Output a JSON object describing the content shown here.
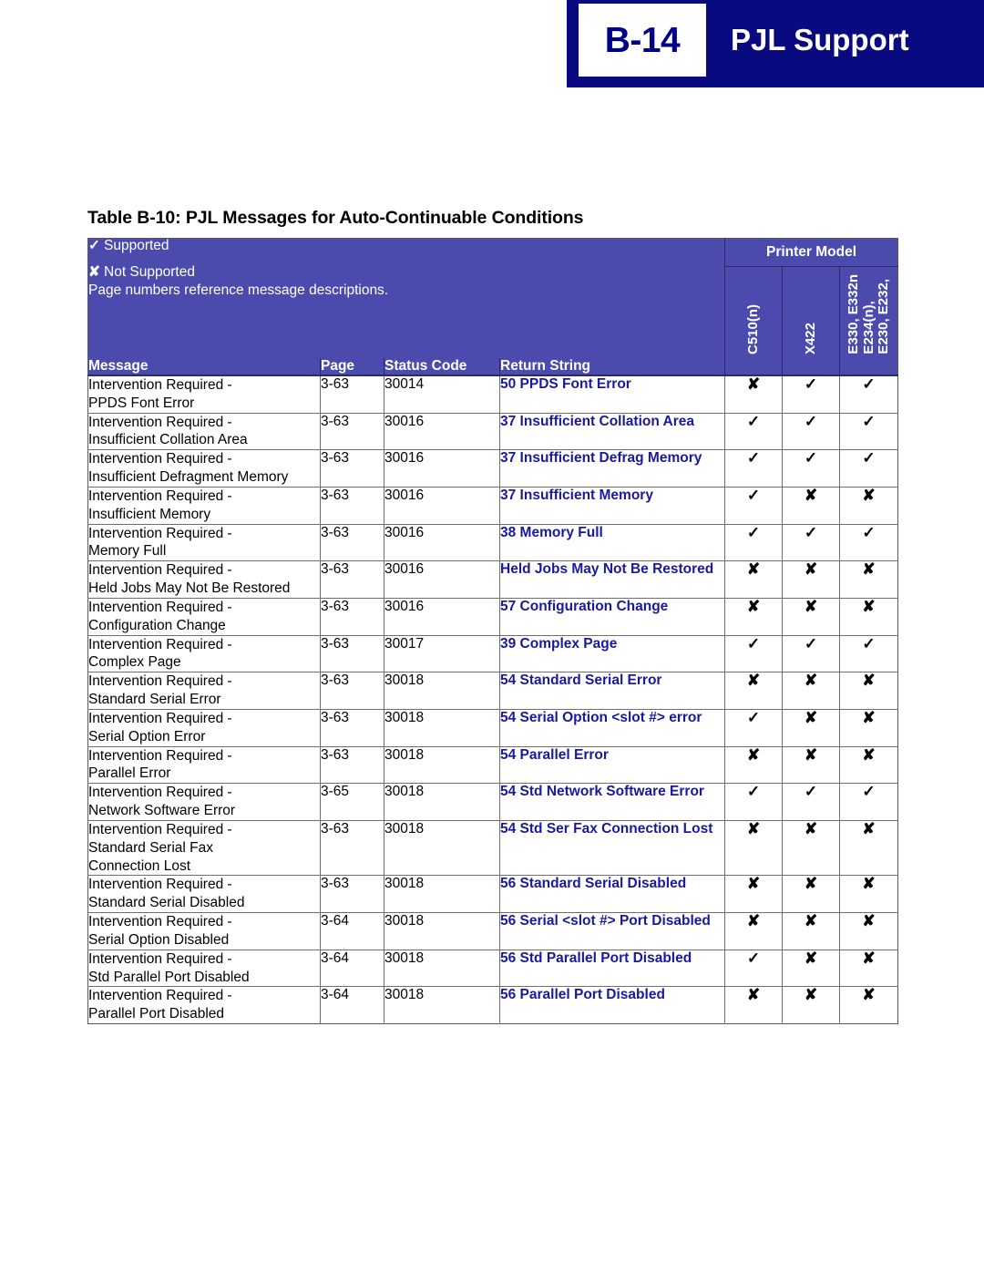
{
  "header": {
    "page_badge": "B-14",
    "title": "PJL Support",
    "navy": "#0a0a80"
  },
  "table_caption": "Table B-10:  PJL Messages for Auto-Continuable Conditions",
  "legend": {
    "supported_mark": "✓",
    "supported_label": "Supported",
    "not_supported_mark": "✘",
    "not_supported_label": "Not Supported",
    "note": "Page numbers reference message descriptions.",
    "header_color": "#4b4bad"
  },
  "table": {
    "printer_model_group": "Printer Model",
    "columns": {
      "message": "Message",
      "page": "Page",
      "status_code": "Status Code",
      "return_string": "Return String"
    },
    "model_columns": [
      {
        "lines": [
          "C510(n)"
        ]
      },
      {
        "lines": [
          "X422"
        ]
      },
      {
        "lines": [
          "E230, E232,",
          "E234(n),",
          "E330, E332n"
        ]
      }
    ],
    "marks": {
      "yes": "✓",
      "no": "✘"
    },
    "rows": [
      {
        "message": [
          "Intervention Required -",
          "PPDS Font Error"
        ],
        "page": "3-63",
        "status_code": "30014",
        "return_string": "50 PPDS Font Error",
        "support": [
          "✘",
          "✓",
          "✓"
        ]
      },
      {
        "message": [
          "Intervention Required -",
          "Insufficient Collation Area"
        ],
        "page": "3-63",
        "status_code": "30016",
        "return_string": "37 Insufficient Collation Area",
        "support": [
          "✓",
          "✓",
          "✓"
        ]
      },
      {
        "message": [
          "Intervention Required -",
          "Insufficient Defragment Memory"
        ],
        "page": "3-63",
        "status_code": "30016",
        "return_string": "37 Insufficient Defrag Memory",
        "support": [
          "✓",
          "✓",
          "✓"
        ]
      },
      {
        "message": [
          "Intervention Required -",
          "Insufficient Memory"
        ],
        "page": "3-63",
        "status_code": "30016",
        "return_string": "37 Insufficient Memory",
        "support": [
          "✓",
          "✘",
          "✘"
        ]
      },
      {
        "message": [
          "Intervention Required -",
          "Memory Full"
        ],
        "page": "3-63",
        "status_code": "30016",
        "return_string": "38 Memory Full",
        "support": [
          "✓",
          "✓",
          "✓"
        ]
      },
      {
        "message": [
          "Intervention Required -",
          "Held Jobs May Not Be Restored"
        ],
        "page": "3-63",
        "status_code": "30016",
        "return_string": "Held Jobs May Not Be Restored",
        "support": [
          "✘",
          "✘",
          "✘"
        ]
      },
      {
        "message": [
          "Intervention Required -",
          "Configuration Change"
        ],
        "page": "3-63",
        "status_code": "30016",
        "return_string": "57 Configuration Change",
        "support": [
          "✘",
          "✘",
          "✘"
        ]
      },
      {
        "message": [
          "Intervention Required -",
          "Complex Page"
        ],
        "page": "3-63",
        "status_code": "30017",
        "return_string": "39 Complex Page",
        "support": [
          "✓",
          "✓",
          "✓"
        ]
      },
      {
        "message": [
          "Intervention Required -",
          "Standard Serial Error"
        ],
        "page": "3-63",
        "status_code": "30018",
        "return_string": "54 Standard Serial Error",
        "support": [
          "✘",
          "✘",
          "✘"
        ]
      },
      {
        "message": [
          "Intervention Required -",
          "Serial Option Error"
        ],
        "page": "3-63",
        "status_code": "30018",
        "return_string": "54 Serial Option <slot #> error",
        "support": [
          "✓",
          "✘",
          "✘"
        ]
      },
      {
        "message": [
          "Intervention Required -",
          "Parallel Error"
        ],
        "page": "3-63",
        "status_code": "30018",
        "return_string": "54 Parallel Error",
        "support": [
          "✘",
          "✘",
          "✘"
        ]
      },
      {
        "message": [
          "Intervention Required -",
          "Network Software Error"
        ],
        "page": "3-65",
        "status_code": "30018",
        "return_string": "54 Std Network Software Error",
        "support": [
          "✓",
          "✓",
          "✓"
        ]
      },
      {
        "message": [
          "Intervention Required -",
          "Standard Serial Fax",
          "Connection Lost"
        ],
        "page": "3-63",
        "status_code": "30018",
        "return_string": "54 Std Ser Fax Connection Lost",
        "support": [
          "✘",
          "✘",
          "✘"
        ]
      },
      {
        "message": [
          "Intervention Required -",
          "Standard Serial Disabled"
        ],
        "page": "3-63",
        "status_code": "30018",
        "return_string": "56 Standard Serial Disabled",
        "support": [
          "✘",
          "✘",
          "✘"
        ]
      },
      {
        "message": [
          "Intervention Required -",
          "Serial Option Disabled"
        ],
        "page": "3-64",
        "status_code": "30018",
        "return_string": "56 Serial <slot #> Port Disabled",
        "support": [
          "✘",
          "✘",
          "✘"
        ]
      },
      {
        "message": [
          "Intervention Required -",
          "Std Parallel Port Disabled"
        ],
        "page": "3-64",
        "status_code": "30018",
        "return_string": "56 Std Parallel Port Disabled",
        "support": [
          "✓",
          "✘",
          "✘"
        ]
      },
      {
        "message": [
          "Intervention Required -",
          "Parallel Port Disabled"
        ],
        "page": "3-64",
        "status_code": "30018",
        "return_string": "56 Parallel Port Disabled",
        "support": [
          "✘",
          "✘",
          "✘"
        ]
      }
    ]
  }
}
